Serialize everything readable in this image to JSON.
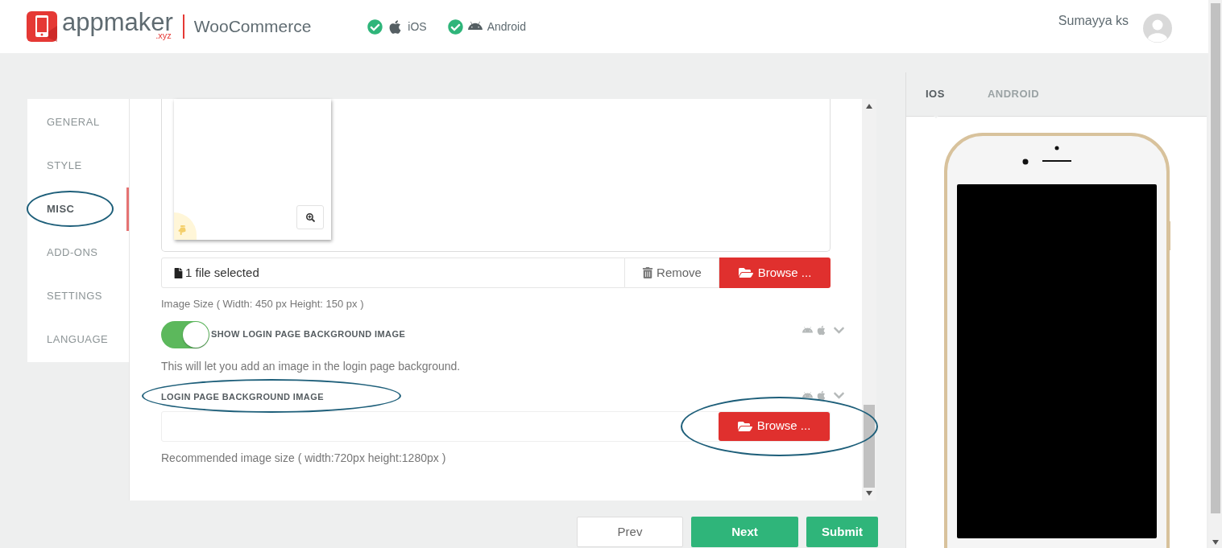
{
  "header": {
    "brand": "appmaker",
    "brand_suffix": ".xyz",
    "platform": "WooCommerce",
    "targets": [
      {
        "kind": "ios",
        "label": "iOS",
        "checked": true
      },
      {
        "kind": "android",
        "label": "Android",
        "checked": true
      }
    ],
    "user": "Sumayya ks"
  },
  "sidebar": {
    "items": [
      {
        "label": "GENERAL",
        "selected": false
      },
      {
        "label": "STYLE",
        "selected": false
      },
      {
        "label": "MISC",
        "selected": true
      },
      {
        "label": "ADD-ONS",
        "selected": false
      },
      {
        "label": "SETTINGS",
        "selected": false
      },
      {
        "label": "LANGUAGE",
        "selected": false
      }
    ]
  },
  "form": {
    "file_input": {
      "value": "1 file selected",
      "remove": "Remove",
      "browse": "Browse ..."
    },
    "image_size_hint": "Image Size ( Width: 450 px Height: 150 px )",
    "toggle": {
      "label": "SHOW LOGIN PAGE BACKGROUND IMAGE",
      "on": true,
      "help": "This will let you add an image in the login page background."
    },
    "background_image": {
      "label": "LOGIN PAGE BACKGROUND IMAGE",
      "browse": "Browse ...",
      "hint": "Recommended image size ( width:720px height:1280px )"
    }
  },
  "actions": [
    {
      "kind": "secondary",
      "label": "Prev"
    },
    {
      "kind": "primary",
      "label": "Next"
    },
    {
      "kind": "primary",
      "label": "Submit"
    }
  ],
  "preview": {
    "tabs": [
      {
        "label": "IOS",
        "selected": true
      },
      {
        "label": "ANDROID",
        "selected": false
      }
    ]
  }
}
